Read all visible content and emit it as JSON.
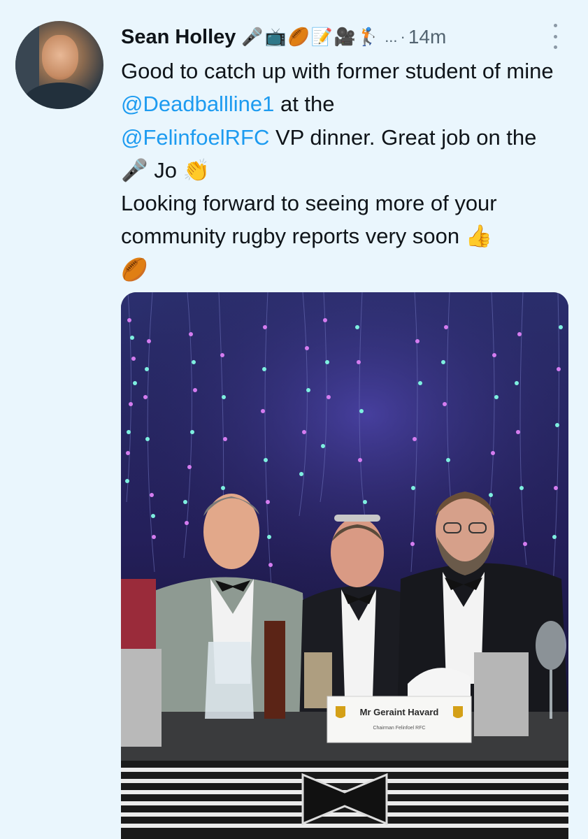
{
  "tweet": {
    "author_name": "Sean Holley",
    "name_emojis": "🎤📺🏉📝🎥🏌",
    "name_truncation": "...",
    "separator": "·",
    "timestamp": "14m",
    "text": {
      "p1": "Good to catch up with former student of mine",
      "mention1": "@Deadballline1",
      "p2": "at the",
      "mention2": "@FelinfoelRFC",
      "p3": "VP dinner. Great job on the",
      "p3_emoji": "🎤",
      "p4": "Jo",
      "p4_emoji": "👏",
      "p5": "Looking forward to seeing more of your community rugby reports very soon",
      "p5_emoji": "👍",
      "p6_emoji": "🏉"
    },
    "photo": {
      "name_card_title": "Mr Geraint Havard",
      "name_card_subtitle": "Chairman Felinfoel RFC"
    }
  },
  "colors": {
    "background": "#eaf6fd",
    "text": "#0f1419",
    "secondary_text": "#536471",
    "link": "#1d9bf0"
  }
}
